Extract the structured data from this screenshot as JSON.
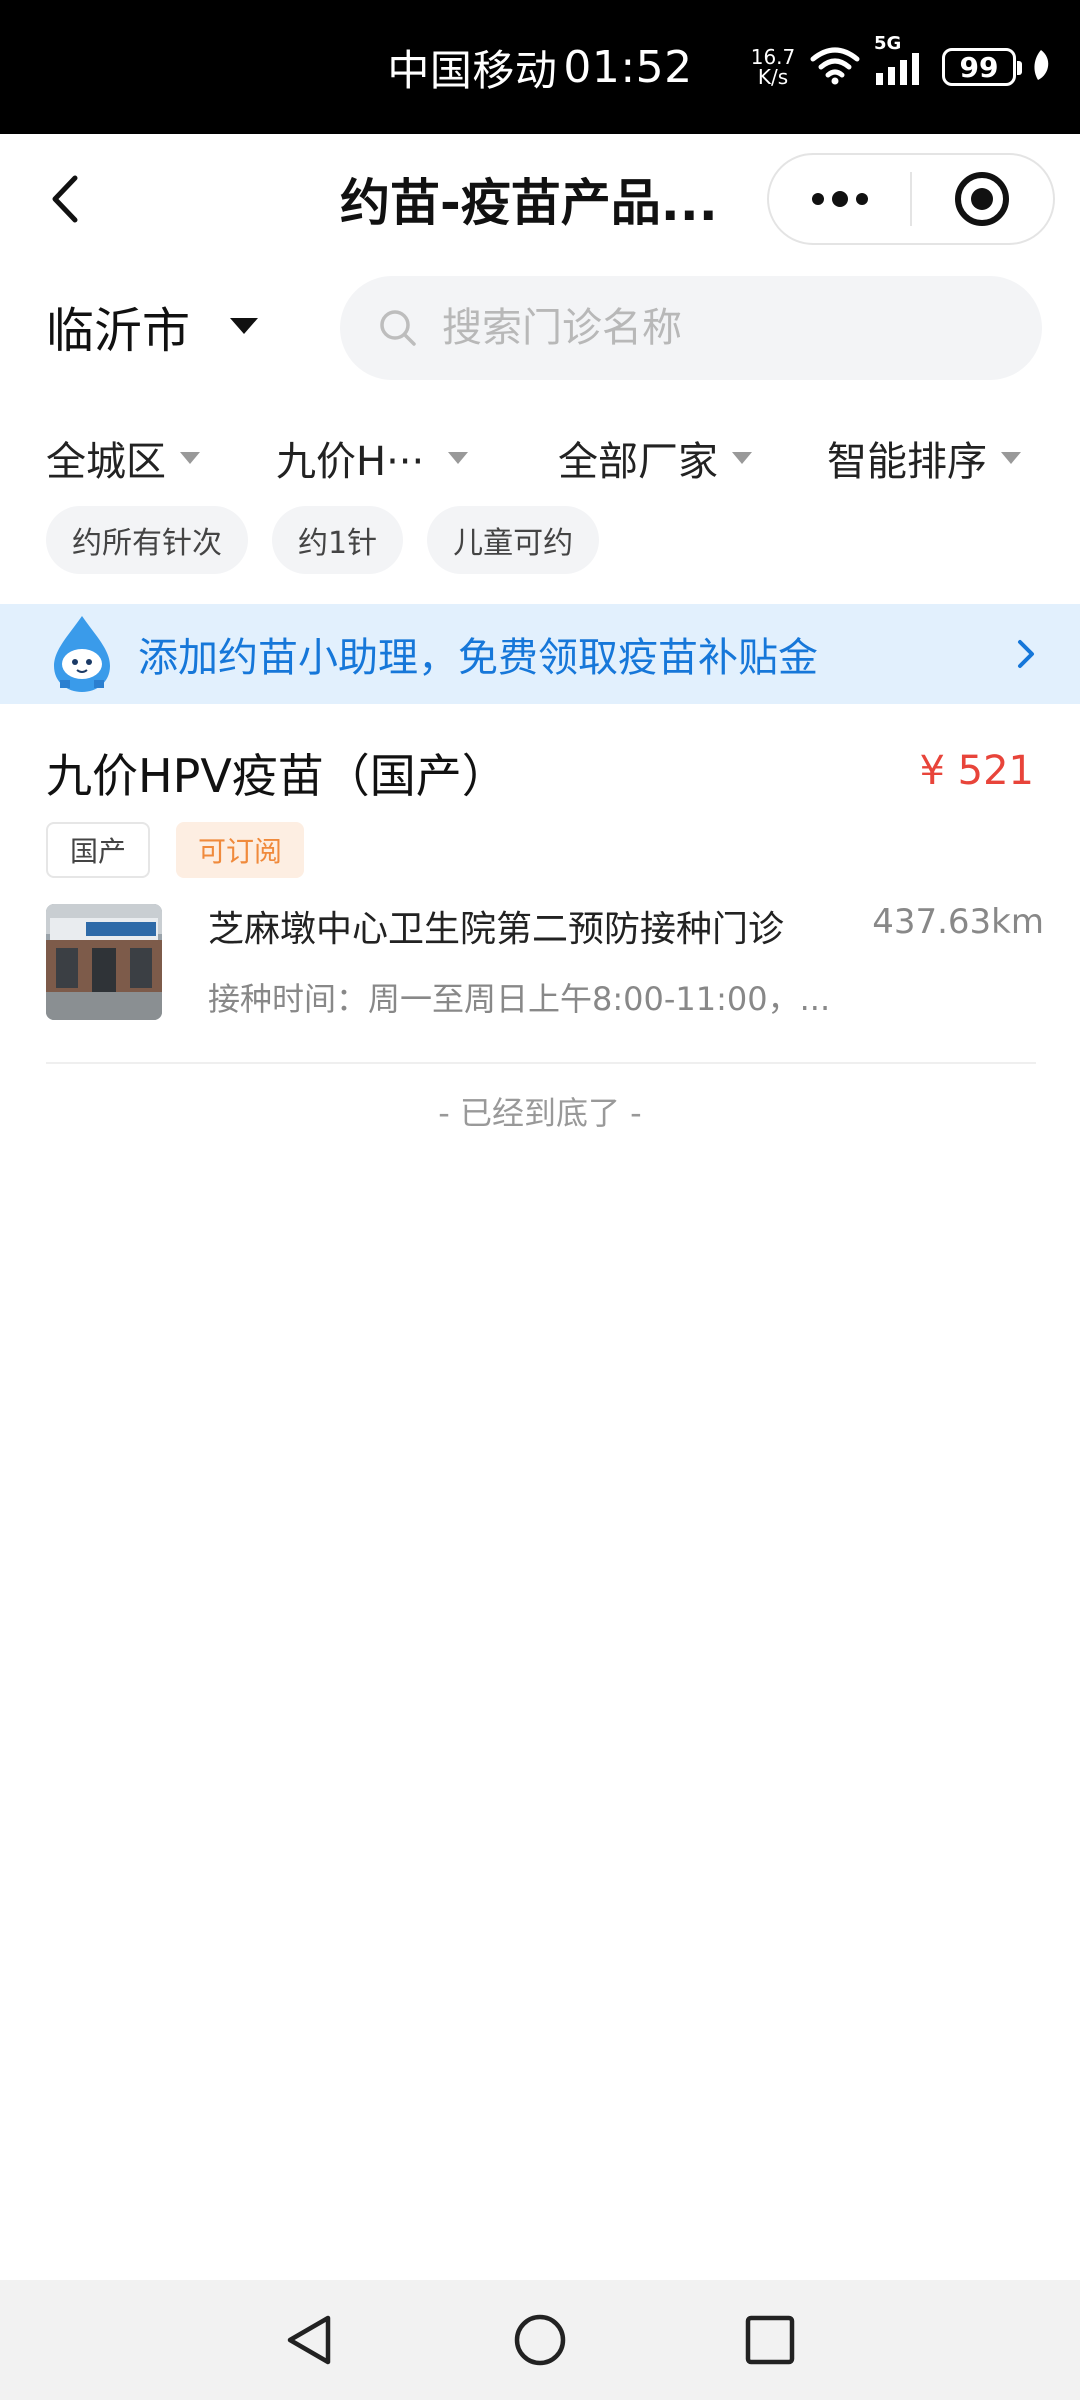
{
  "status_bar": {
    "carrier": "中国移动",
    "time": "01:52",
    "net_speed_value": "16.7",
    "net_speed_unit": "K/s",
    "network_type": "5G",
    "battery": "99"
  },
  "nav": {
    "title": "约苗-疫苗产品..."
  },
  "location": {
    "city": "临沂市"
  },
  "search": {
    "placeholder": "搜索门诊名称",
    "value": ""
  },
  "filters": {
    "district": "全城区",
    "vaccine": "九价H···",
    "manufacturer": "全部厂家",
    "sort": "智能排序"
  },
  "chips": [
    "约所有针次",
    "约1针",
    "儿童可约"
  ],
  "banner": {
    "text": "添加约苗小助理，免费领取疫苗补贴金"
  },
  "vaccine": {
    "name": "九价HPV疫苗（国产）",
    "price": "¥ 521",
    "tags": [
      "国产",
      "可订阅"
    ],
    "clinic": {
      "name": "芝麻墩中心卫生院第二预防接种门诊",
      "distance": "437.63km",
      "hours": "接种时间：周一至周日上午8:00-11:00，..."
    }
  },
  "list_end": "- 已经到底了 -",
  "colors": {
    "accent_blue": "#1677d9",
    "price_red": "#e8443a",
    "tag_orange": "#f08a3c",
    "banner_bg": "#e2f0fd"
  }
}
